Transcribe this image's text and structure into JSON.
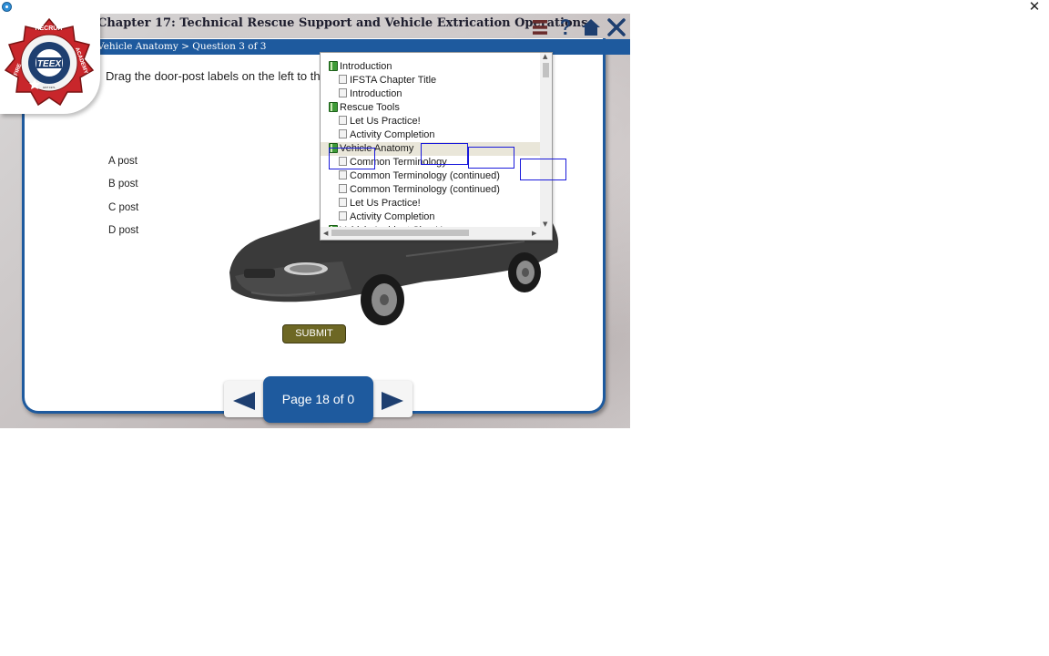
{
  "window": {
    "close_glyph": "✕"
  },
  "header": {
    "chapter_title": "Chapter 17: Technical Rescue Support and Vehicle Extrication Operations",
    "breadcrumb": "Vehicle Anatomy > Question 3 of 3",
    "icons": [
      "menu-icon",
      "help-icon",
      "home-icon",
      "close-icon"
    ]
  },
  "logo": {
    "top_text": "RECRUIT",
    "left_text": "FIRE",
    "right_text": "ACADEMY",
    "inner_text": "EMERGENCY SERVICES TRAINING INSTITUTE",
    "center_text": "TEEX",
    "bottom_text": "EST 1971"
  },
  "question": {
    "instruction": "Drag the door-post labels on the left to th",
    "labels": [
      "A post",
      "B post",
      "C post",
      "D post"
    ],
    "submit_label": "SUBMIT"
  },
  "toc": {
    "items": [
      {
        "label": "Introduction",
        "kind": "section",
        "selected": false
      },
      {
        "label": "IFSTA Chapter Title",
        "kind": "page",
        "selected": false
      },
      {
        "label": "Introduction",
        "kind": "page",
        "selected": false
      },
      {
        "label": "Rescue Tools",
        "kind": "section",
        "selected": false
      },
      {
        "label": "Let Us Practice!",
        "kind": "page",
        "selected": false
      },
      {
        "label": "Activity Completion",
        "kind": "page",
        "selected": false
      },
      {
        "label": "Vehicle Anatomy",
        "kind": "section",
        "selected": true
      },
      {
        "label": "Common Terminology",
        "kind": "page",
        "selected": false
      },
      {
        "label": "Common Terminology (continued)",
        "kind": "page",
        "selected": false
      },
      {
        "label": "Common Terminology (continued)",
        "kind": "page",
        "selected": false
      },
      {
        "label": "Let Us Practice!",
        "kind": "page",
        "selected": false
      },
      {
        "label": "Activity Completion",
        "kind": "page",
        "selected": false
      },
      {
        "label": "Vehicle Incident Size-Up",
        "kind": "section",
        "selected": false
      }
    ]
  },
  "navigation": {
    "page_label": "Page 18 of 0"
  },
  "colors": {
    "brand_blue": "#1e5a9e",
    "submit_olive": "#6d6724",
    "drop_zone_blue": "#1a1adb",
    "logo_red": "#c8262b"
  }
}
